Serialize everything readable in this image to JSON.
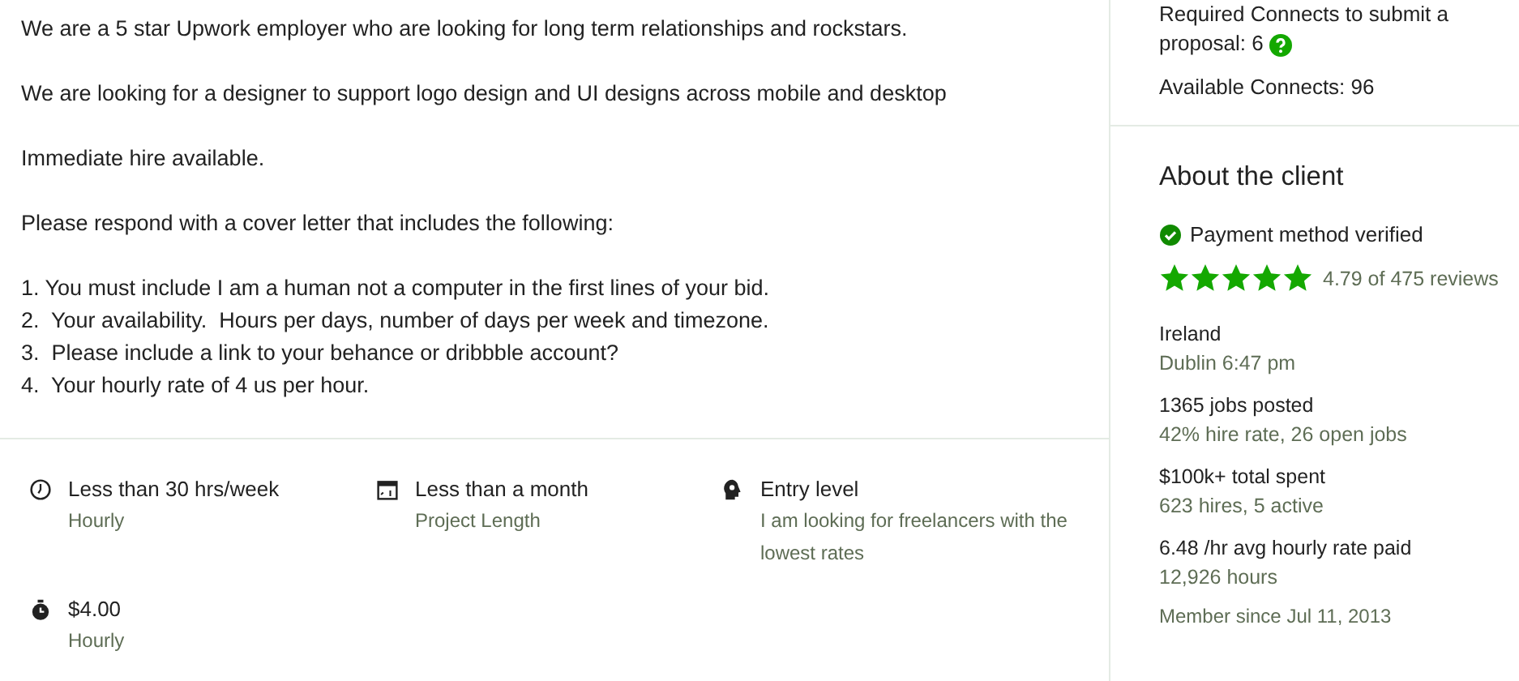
{
  "description": {
    "paragraphs": [
      "We are a 5 star Upwork employer who are looking for long term relationships and rockstars.",
      "We are looking for a designer to support logo design and UI designs across mobile and desktop",
      "Immediate hire available.",
      "Please respond with a cover letter that includes the following:"
    ],
    "list": [
      "1. You must include I am a human not a computer in the first lines of your bid.",
      "2.  Your availability.  Hours per days, number of days per week and timezone.",
      "3.  Please include a link to your behance or dribbble account?",
      "4.  Your hourly rate of 4 us per hour."
    ]
  },
  "features": [
    {
      "kind": "clock",
      "title": "Less than 30 hrs/week",
      "subtitle": "Hourly"
    },
    {
      "kind": "calendar",
      "title": "Less than a month",
      "subtitle": "Project Length"
    },
    {
      "kind": "level",
      "title": "Entry level",
      "subtitle": "I am looking for freelancers with the lowest rates"
    },
    {
      "kind": "timer",
      "title": "$4.00",
      "subtitle": "Hourly"
    }
  ],
  "connects": {
    "required": "Required Connects to submit a proposal: 6",
    "available": "Available Connects: 96"
  },
  "client": {
    "heading": "About the client",
    "payment": "Payment method verified",
    "stars": 5,
    "reviews": "4.79 of 475 reviews",
    "stats": [
      {
        "title": "Ireland",
        "detail": "Dublin 6:47 pm"
      },
      {
        "title": "1365 jobs posted",
        "detail": "42% hire rate, 26 open jobs"
      },
      {
        "title": "$100k+ total spent",
        "detail": "623 hires, 5 active"
      },
      {
        "title": "6.48 /hr avg hourly rate paid",
        "detail": "12,926 hours"
      }
    ],
    "member_since": "Member since Jul 11, 2013"
  }
}
